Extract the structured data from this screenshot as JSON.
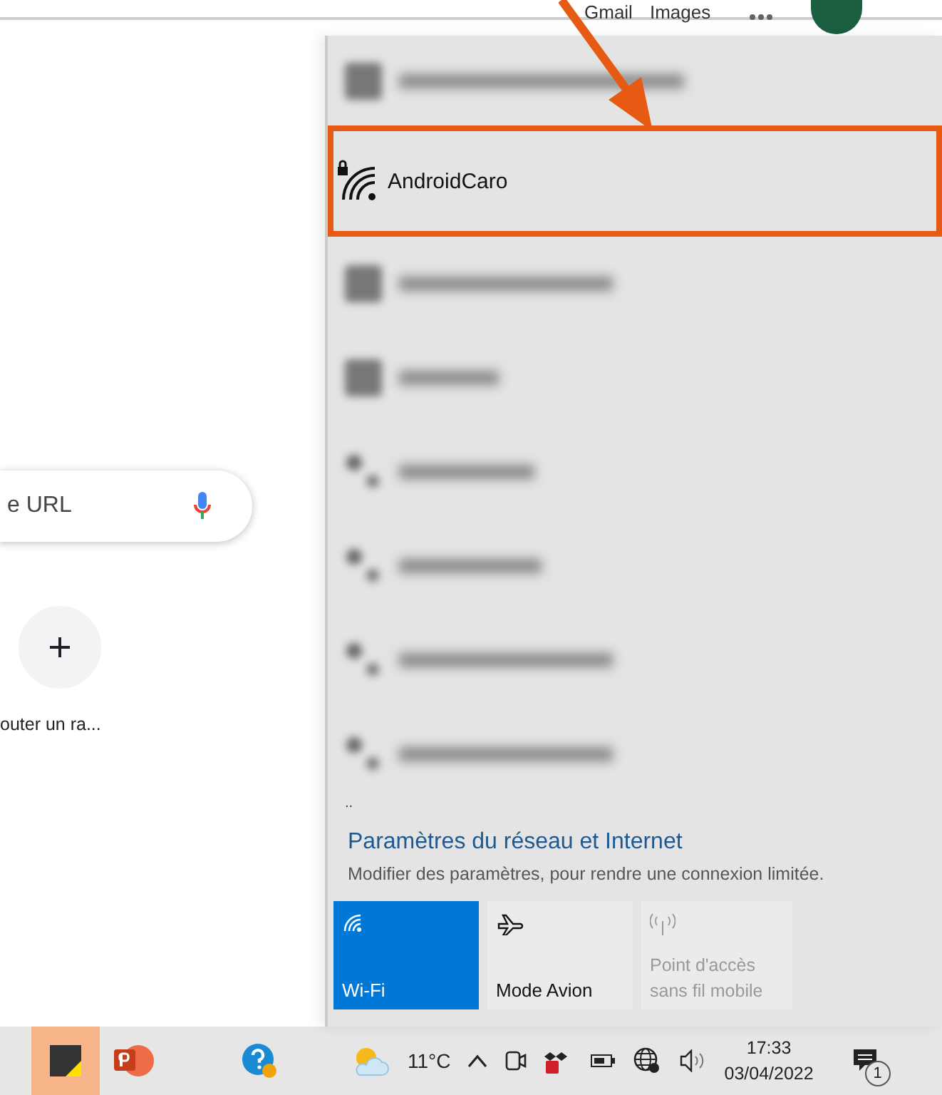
{
  "browser": {
    "header_links": [
      "Gmail",
      "Images"
    ],
    "search_placeholder": "e URL",
    "shortcut_label": "outer un ra..."
  },
  "network_panel": {
    "networks_before": [
      {
        "kind": "wifi"
      }
    ],
    "highlighted_network": {
      "name": "AndroidCaro",
      "secured": true
    },
    "networks_after": [
      {
        "kind": "wifi"
      },
      {
        "kind": "wifi"
      },
      {
        "kind": "adhoc"
      },
      {
        "kind": "adhoc"
      },
      {
        "kind": "adhoc"
      },
      {
        "kind": "adhoc"
      }
    ],
    "more": "..",
    "settings_link": "Paramètres du réseau et Internet",
    "settings_desc": "Modifier des paramètres, pour rendre une connexion limitée.",
    "tiles": [
      {
        "kind": "wifi",
        "label": "Wi-Fi",
        "on": true,
        "disabled": false
      },
      {
        "kind": "airplane",
        "label": "Mode Avion",
        "on": false,
        "disabled": false
      },
      {
        "kind": "hotspot",
        "label": "Point d'accès sans fil mobile",
        "on": false,
        "disabled": true
      }
    ]
  },
  "taskbar": {
    "apps": [
      {
        "kind": "notes",
        "selected": true
      },
      {
        "kind": "powerpoint",
        "selected": false
      },
      {
        "kind": "help",
        "selected": false
      }
    ],
    "temperature": "11°C",
    "time": "17:33",
    "date": "03/04/2022",
    "notification_count": "1"
  }
}
